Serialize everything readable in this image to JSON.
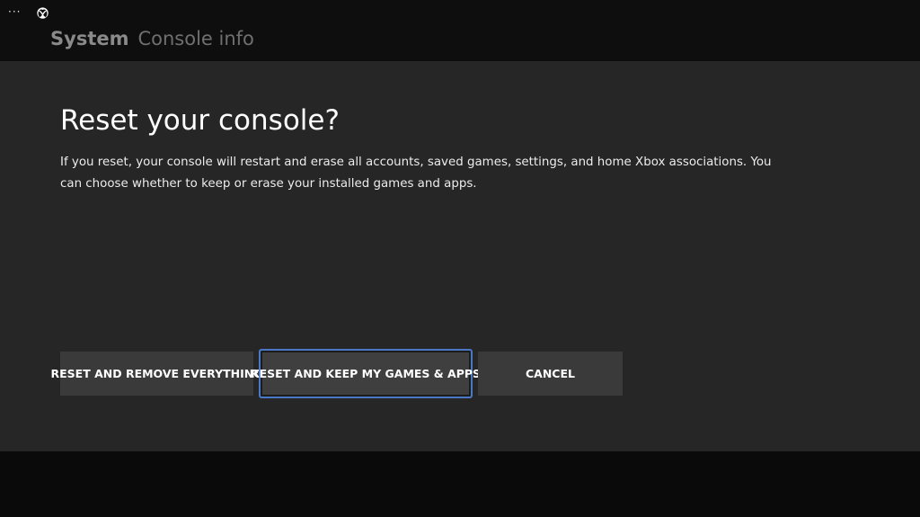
{
  "system_bar": {
    "menu_dots": "···",
    "logo_icon": "xbox-logo-icon"
  },
  "header": {
    "section": "System",
    "page": "Console info"
  },
  "dialog": {
    "title": "Reset your console?",
    "body": "If you reset, your console will restart and erase all accounts, saved games, settings, and home Xbox associations. You can choose whether to keep or erase your installed games and apps.",
    "buttons": {
      "remove_everything": "RESET AND REMOVE EVERYTHING",
      "keep_games_apps": "RESET AND KEEP MY GAMES & APPS",
      "cancel": "CANCEL"
    },
    "focused_button": "keep_games_apps",
    "focus_color": "#4a78c6"
  }
}
